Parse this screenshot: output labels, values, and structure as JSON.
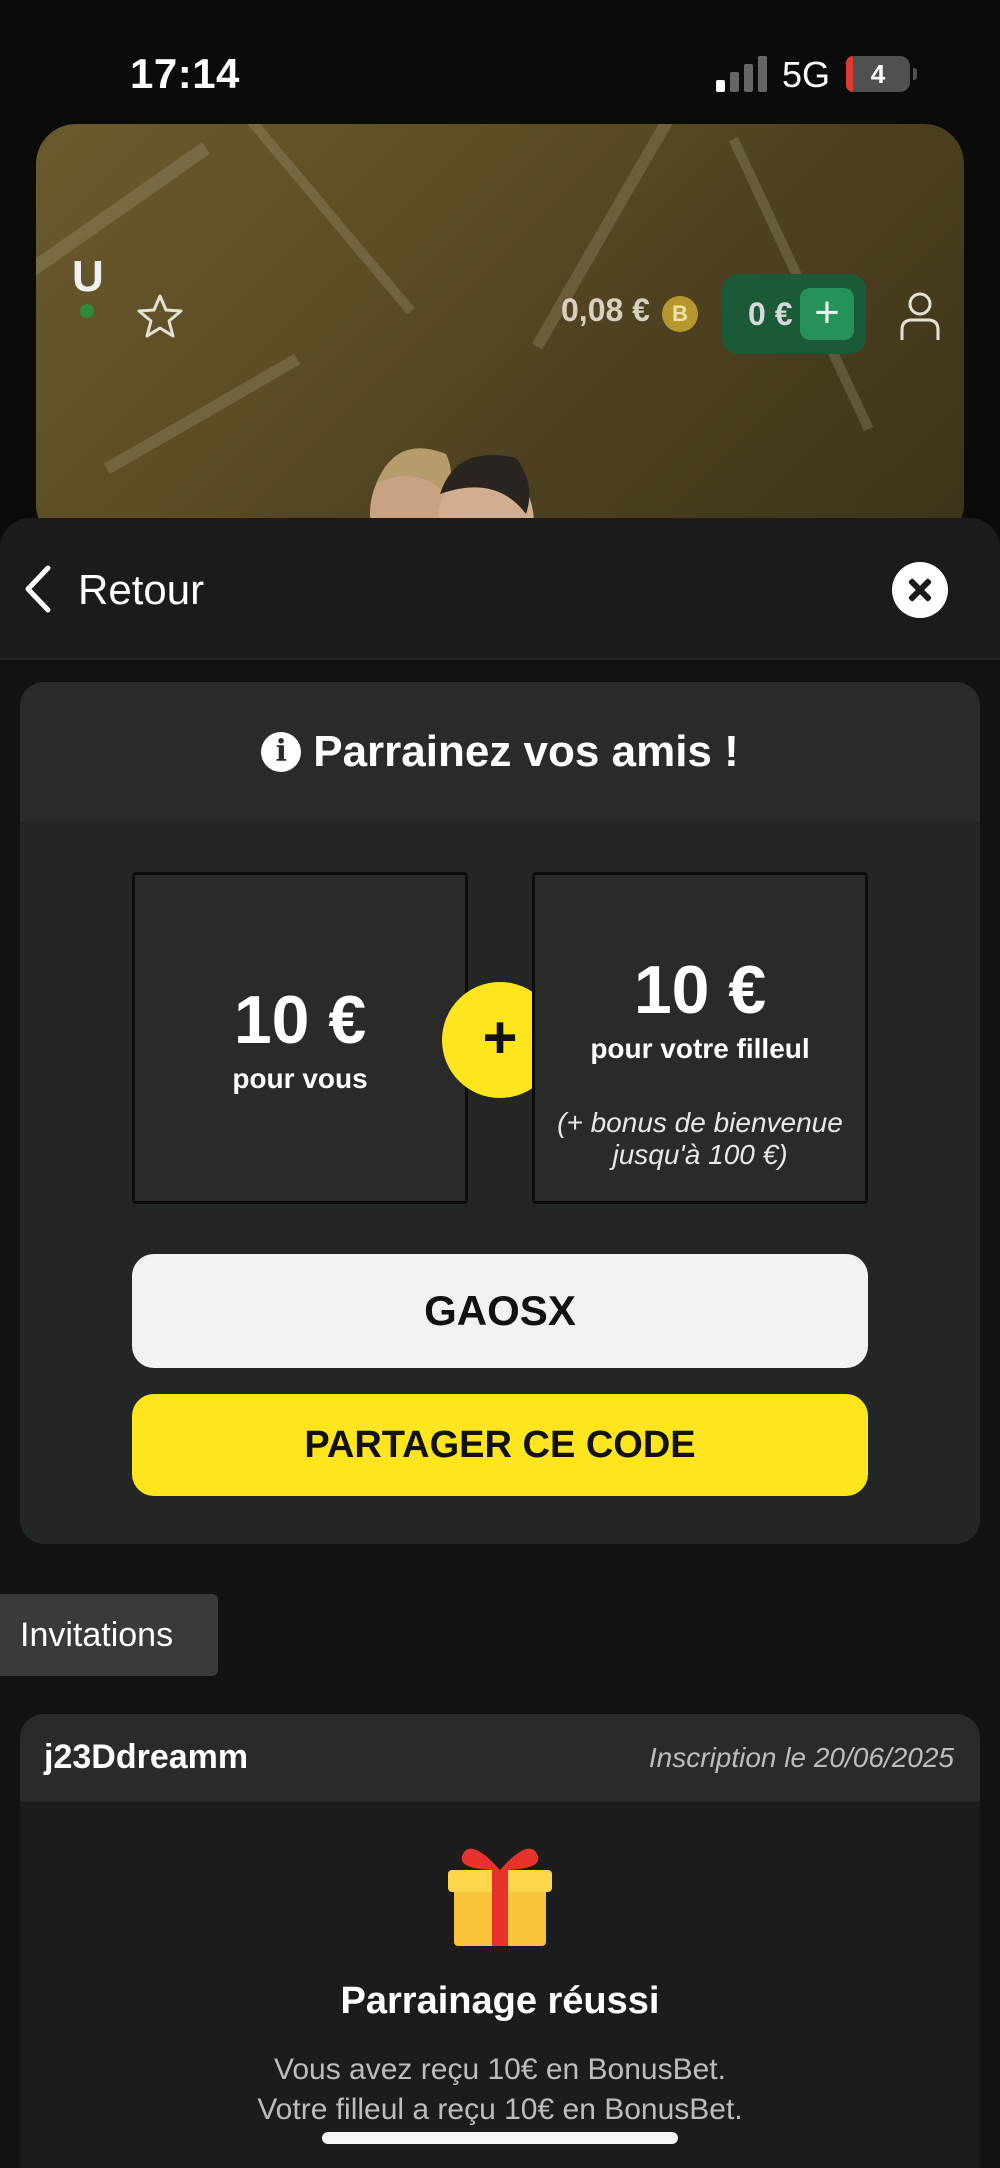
{
  "status_bar": {
    "time": "17:14",
    "network": "5G",
    "battery": "4"
  },
  "background_app": {
    "logo": "U",
    "coins": "0,08 €",
    "coin_badge": "B",
    "wallet": "0 €",
    "wallet_plus": "+"
  },
  "topbar": {
    "back_label": "Retour"
  },
  "referral": {
    "title": "Parrainez vos amis !",
    "info_icon": "i",
    "you": {
      "amount": "10 €",
      "label": "pour vous"
    },
    "plus": "+",
    "friend": {
      "amount": "10 €",
      "label": "pour votre filleul",
      "note": "(+ bonus de bienvenue jusqu'à 100 €)"
    },
    "code": "GAOSX",
    "share_label": "PARTAGER CE CODE"
  },
  "tabs": {
    "invitations": "Invitations"
  },
  "invitation": {
    "user": "j23Ddreamm",
    "date": "Inscription le 20/06/2025",
    "status_title": "Parrainage réussi",
    "line1": "Vous avez reçu 10€ en BonusBet.",
    "line2": "Votre filleul a reçu 10€ en BonusBet."
  },
  "colors": {
    "accent_yellow": "#ffe51e",
    "wallet_green": "#1b5a36",
    "sheet_bg": "#121212"
  }
}
